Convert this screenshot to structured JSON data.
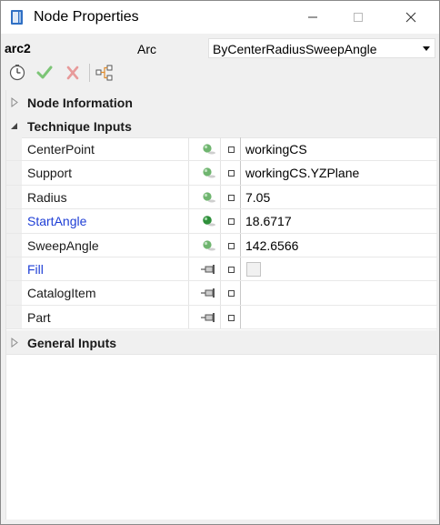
{
  "window": {
    "title": "Node Properties",
    "app_icon": "node-properties-app-icon",
    "buttons": [
      "minimize-icon",
      "maximize-icon",
      "close-icon"
    ]
  },
  "header": {
    "node_name": "arc2",
    "node_type": "Arc",
    "method": "ByCenterRadiusSweepAngle"
  },
  "toolbar": {
    "icons": [
      "clock-icon",
      "apply-checkmark-icon",
      "cancel-x-icon",
      "graph-tree-icon"
    ]
  },
  "sections": {
    "node_information": "Node Information",
    "technique_inputs": "Technique Inputs",
    "general_inputs": "General Inputs"
  },
  "properties": [
    {
      "name": "CenterPoint",
      "value": "workingCS",
      "status": "green-dot",
      "highlight": false
    },
    {
      "name": "Support",
      "value": "workingCS.YZPlane",
      "status": "green-dot",
      "highlight": false
    },
    {
      "name": "Radius",
      "value": "7.05",
      "status": "green-dot",
      "highlight": false
    },
    {
      "name": "StartAngle",
      "value": "18.6717",
      "status": "green-dot-strong",
      "highlight": true
    },
    {
      "name": "SweepAngle",
      "value": "142.6566",
      "status": "green-dot",
      "highlight": false
    },
    {
      "name": "Fill",
      "value": "",
      "status": "pin",
      "highlight": true,
      "checkbox": true
    },
    {
      "name": "CatalogItem",
      "value": "",
      "status": "pin",
      "highlight": false
    },
    {
      "name": "Part",
      "value": "",
      "status": "pin",
      "highlight": false
    }
  ],
  "colors": {
    "highlight_text": "#1f3fd6",
    "green_dot": "#6fb56f",
    "green_dot_strong": "#2e8f3a",
    "check_green": "#7cc576",
    "cancel_red": "#e79a9a"
  }
}
